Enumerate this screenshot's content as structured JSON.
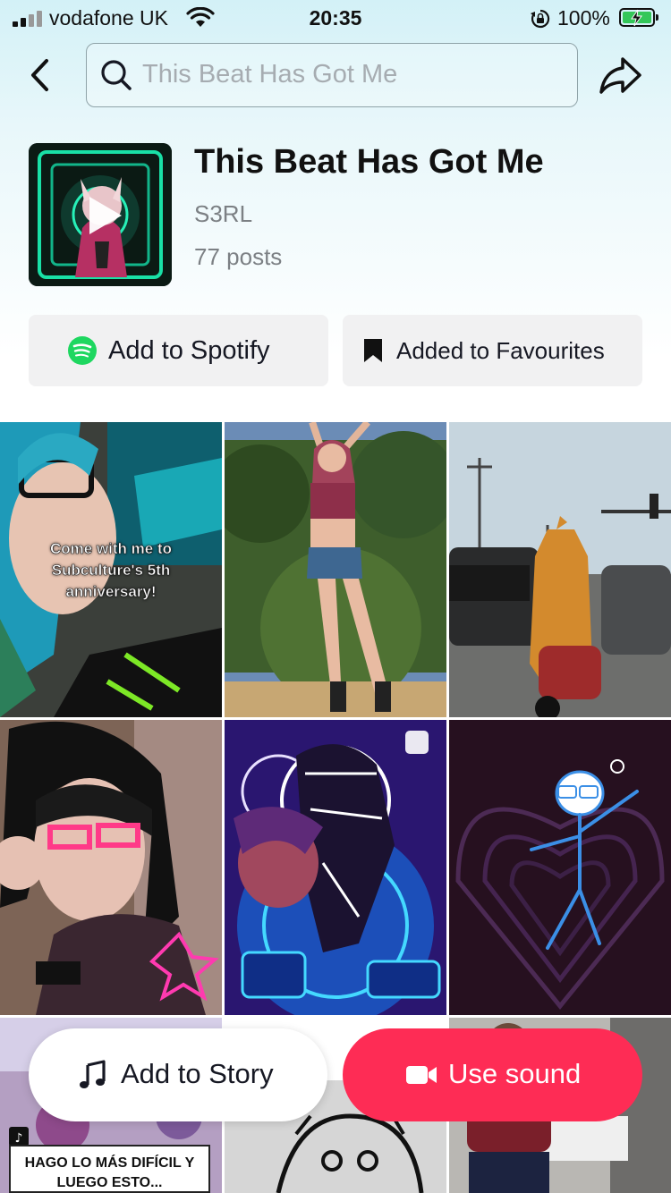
{
  "status_bar": {
    "carrier": "vodafone UK",
    "time": "20:35",
    "battery_percent": "100%",
    "battery_level": 1.0,
    "signal_bars": 3
  },
  "header": {
    "search_value": "This Beat Has Got Me",
    "back_icon": "chevron-left-icon",
    "share_icon": "share-arrow-icon"
  },
  "song": {
    "title": "This Beat Has Got Me",
    "artist": "S3RL",
    "posts": "77 posts"
  },
  "actions": {
    "spotify_label": "Add to Spotify",
    "favourites_label": "Added to Favourites",
    "spotify_color": "#1ed760"
  },
  "videos": [
    {
      "caption": "Come with me to Subculture's 5th anniversary!"
    },
    {
      "caption": ""
    },
    {
      "caption": ""
    },
    {
      "caption": ""
    },
    {
      "caption": ""
    },
    {
      "caption": ""
    },
    {
      "caption": "HAGO LO MÁS DIFÍCIL Y LUEGO ESTO..."
    },
    {
      "caption": ""
    },
    {
      "caption": ""
    }
  ],
  "bottom_bar": {
    "add_story_label": "Add to Story",
    "use_sound_label": "Use sound",
    "accent_color": "#fe2c55"
  }
}
